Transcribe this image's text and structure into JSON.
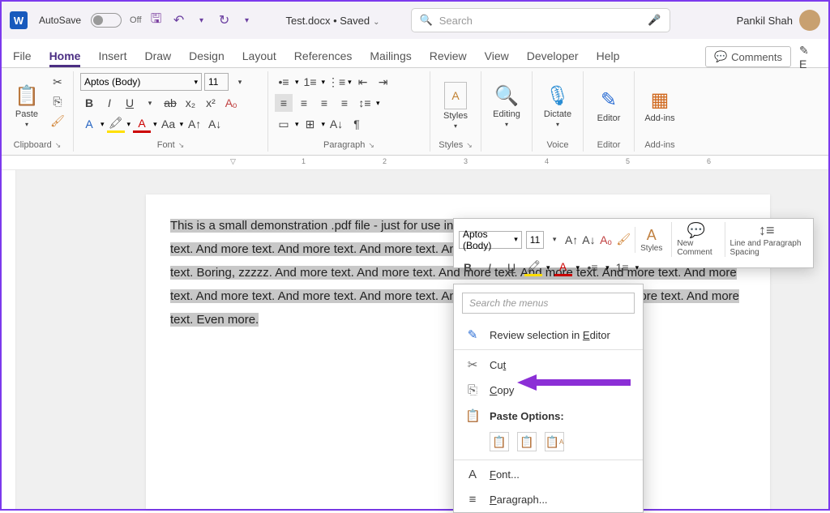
{
  "titlebar": {
    "autosave_label": "AutoSave",
    "autosave_state": "Off",
    "doc_title": "Test.docx",
    "save_state": "Saved",
    "search_placeholder": "Search",
    "user_name": "Pankil Shah"
  },
  "tabs": {
    "file": "File",
    "home": "Home",
    "insert": "Insert",
    "draw": "Draw",
    "design": "Design",
    "layout": "Layout",
    "references": "References",
    "mailings": "Mailings",
    "review": "Review",
    "view": "View",
    "developer": "Developer",
    "help": "Help",
    "comments_btn": "Comments"
  },
  "ribbon": {
    "clipboard": {
      "paste": "Paste",
      "label": "Clipboard"
    },
    "font": {
      "name": "Aptos (Body)",
      "size": "11",
      "label": "Font"
    },
    "paragraph": {
      "label": "Paragraph"
    },
    "styles": {
      "btn": "Styles",
      "label": "Styles"
    },
    "editing": {
      "btn": "Editing"
    },
    "voice": {
      "dictate": "Dictate",
      "label": "Voice"
    },
    "editor": {
      "btn": "Editor",
      "label": "Editor"
    },
    "addins": {
      "btn": "Add-ins",
      "label": "Add-ins"
    }
  },
  "ruler_marks": [
    "1",
    "2",
    "3",
    "4",
    "5",
    "6"
  ],
  "document_text": "This is a small demonstration .pdf file - just for use in the Virtual Mechanics tutorials. More text. And more text. And more text. And more text. And more text. And more text. And more text. And more text. And more text. Boring, zzzzz. And more text. And more text. And more text. And more text. And more text. And more text. And more text. And more text. And more text. And more text. And more text. And more text. And more text. Even more.",
  "minitoolbar": {
    "font_name": "Aptos (Body)",
    "font_size": "11",
    "styles": "Styles",
    "new_comment": "New Comment",
    "line_spacing": "Line and Paragraph Spacing"
  },
  "context_menu": {
    "search_placeholder": "Search the menus",
    "review_editor": "Review selection in Editor",
    "cut": "Cut",
    "copy": "Copy",
    "paste_options": "Paste Options:",
    "font": "Font...",
    "paragraph": "Paragraph..."
  }
}
